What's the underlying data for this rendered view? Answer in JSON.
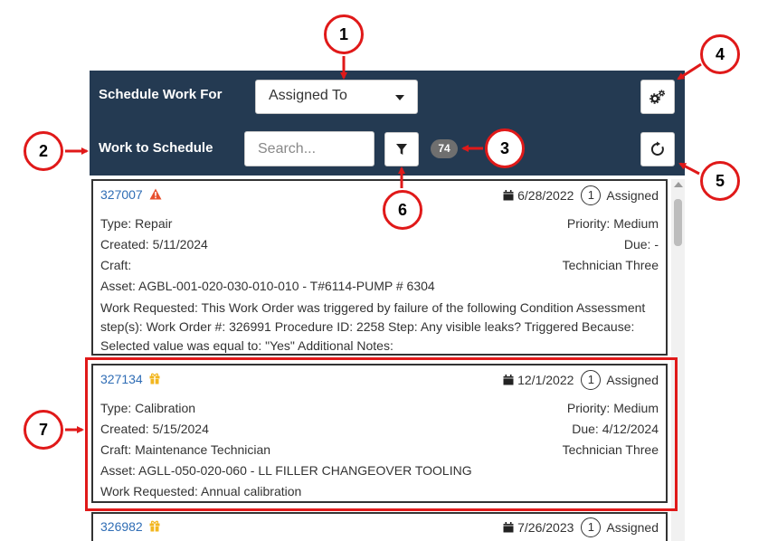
{
  "header": {
    "schedule_label": "Schedule Work For",
    "schedule_value": "Assigned To",
    "work_label": "Work to Schedule",
    "search_placeholder": "Search...",
    "count": "74"
  },
  "work_orders": [
    {
      "id": "327007",
      "flag_icon": "warning-icon",
      "date": "6/28/2022",
      "status_num": "1",
      "status": "Assigned",
      "type": "Type: Repair",
      "priority": "Priority: Medium",
      "created": "Created: 5/11/2024",
      "due": "Due: -",
      "craft": "Craft:",
      "assignee": "Technician Three",
      "asset": "Asset: AGBL-001-020-030-010-010 - T#6114-PUMP # 6304",
      "requested": "Work Requested: This Work Order was triggered by failure of the following Condition Assessment step(s): Work Order #: 326991 Procedure ID: 2258 Step: Any visible leaks? Triggered Because: Selected value was equal to: \"Yes\" Additional Notes:"
    },
    {
      "id": "327134",
      "flag_icon": "gift-icon",
      "date": "12/1/2022",
      "status_num": "1",
      "status": "Assigned",
      "type": "Type: Calibration",
      "priority": "Priority: Medium",
      "created": "Created: 5/15/2024",
      "due": "Due: 4/12/2024",
      "craft": "Craft: Maintenance Technician",
      "assignee": "Technician Three",
      "asset": "Asset: AGLL-050-020-060 - LL FILLER CHANGEOVER TOOLING",
      "requested": "Work Requested: Annual calibration"
    },
    {
      "id": "326982",
      "flag_icon": "gift-icon",
      "date": "7/26/2023",
      "status_num": "1",
      "status": "Assigned"
    }
  ],
  "callouts": [
    "1",
    "2",
    "3",
    "4",
    "5",
    "6",
    "7"
  ],
  "colors": {
    "header_bg": "#243a52",
    "link": "#2f6db5",
    "annotation_red": "#e01919",
    "warning": "#e8502e",
    "gift": "#f2b61f",
    "badge": "#6f6f6f"
  }
}
